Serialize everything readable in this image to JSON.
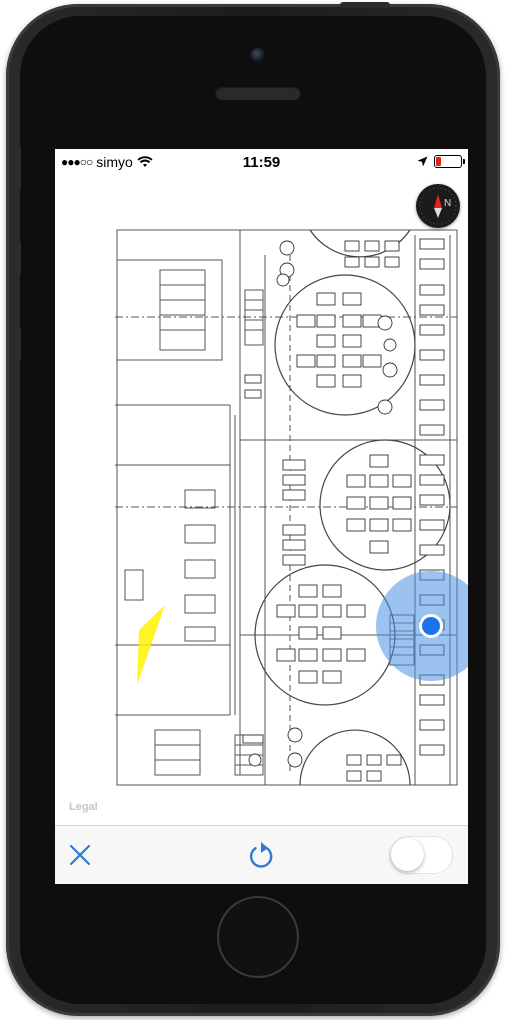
{
  "status_bar": {
    "signal": "●●●○○",
    "carrier": "simyo",
    "time": "11:59",
    "battery_level_fraction": 0.15,
    "battery_color": "#e0241b"
  },
  "compass": {
    "icon": "compass-icon",
    "north_label": "N",
    "needle_color": "#e0241b"
  },
  "map": {
    "legal_label": "Legal",
    "location_color": "#1a73e8",
    "accuracy_color": "#4a90e2",
    "heading_color": "#fff200"
  },
  "toolbar": {
    "close_icon": "close-icon",
    "refresh_icon": "refresh-icon",
    "accent_color": "#2b7cd3",
    "toggle_on": false
  }
}
